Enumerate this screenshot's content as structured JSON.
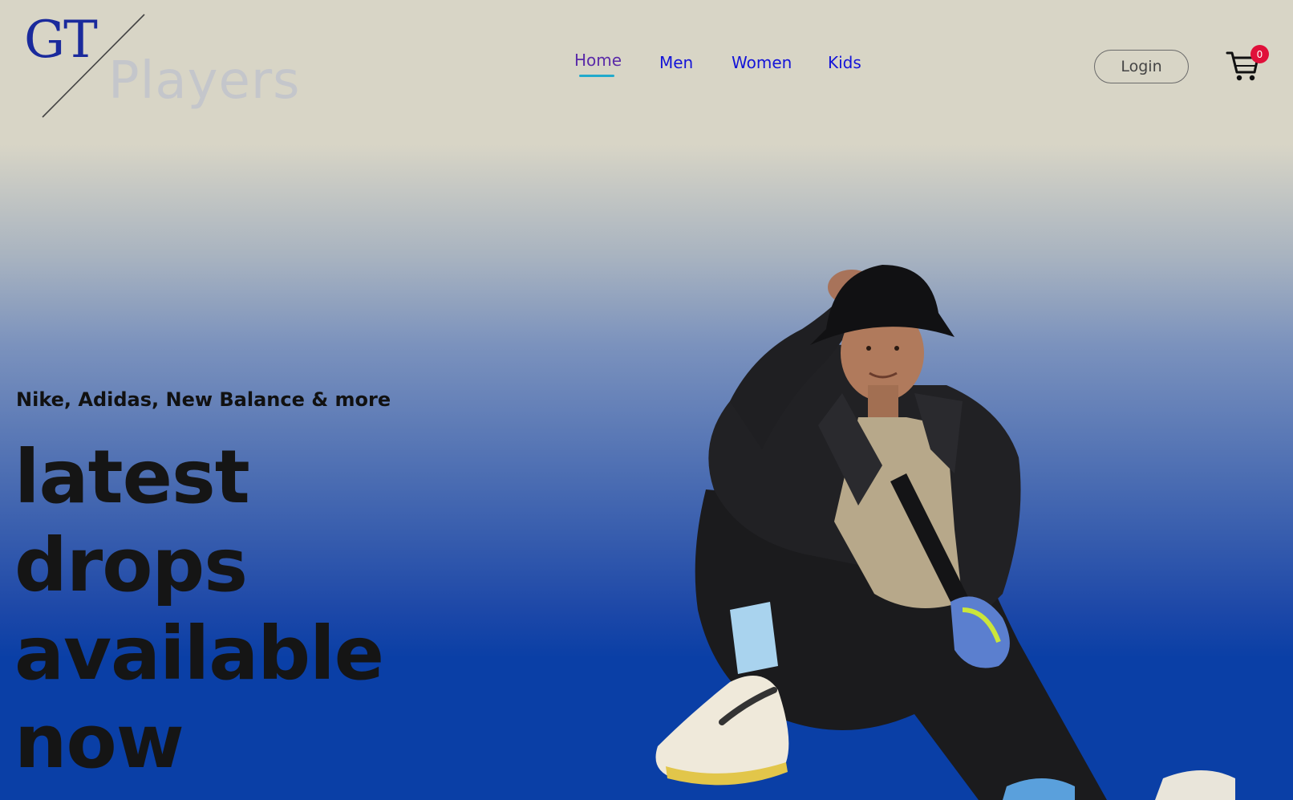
{
  "logo": {
    "gt": "GT",
    "players": "Players"
  },
  "nav": {
    "items": [
      {
        "label": "Home",
        "active": true
      },
      {
        "label": "Men",
        "active": false
      },
      {
        "label": "Women",
        "active": false
      },
      {
        "label": "Kids",
        "active": false
      }
    ]
  },
  "header": {
    "login_label": "Login",
    "cart_count": "0"
  },
  "hero": {
    "brands": "Nike, Adidas, New Balance & more",
    "headline": [
      "latest",
      "drops",
      "available",
      "now"
    ]
  },
  "colors": {
    "nav_link": "#1414d8",
    "nav_active": "#5a2aa8",
    "nav_underline": "#22aacc",
    "badge": "#e0103a",
    "logo_gt": "#1a2a9c"
  },
  "icons": {
    "cart": "shopping-cart-icon"
  }
}
